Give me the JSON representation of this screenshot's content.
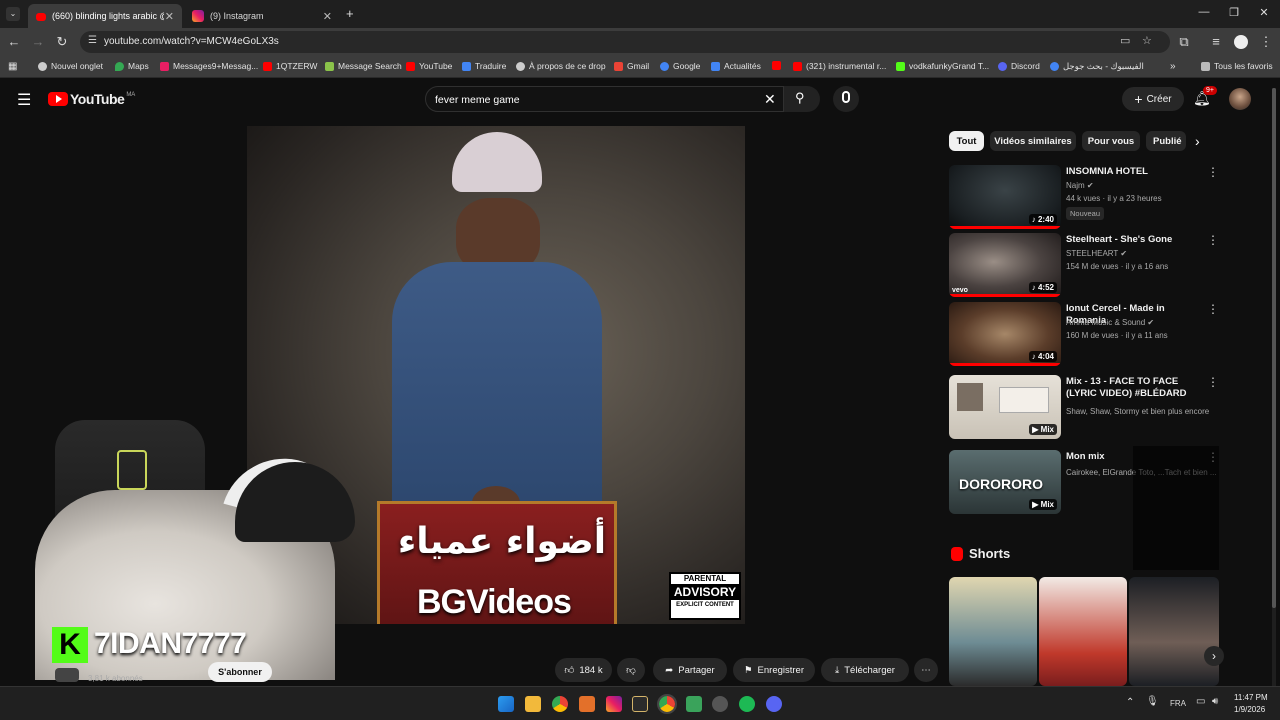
{
  "browser": {
    "tabs": [
      {
        "title": "(660) blinding lights arabic @..."
      },
      {
        "title": "(9) Instagram"
      }
    ],
    "url": "youtube.com/watch?v=MCW4eGoLX3s",
    "bookmarks": [
      "Nouvel onglet",
      "Maps",
      "Messages9+Messag...",
      "1QTZERW",
      "Message Search",
      "YouTube",
      "Traduire",
      "À propos de ce drop",
      "Gmail",
      "Google",
      "Actualités",
      "(321) instrumental r...",
      "vodkafunkyGrand T...",
      "Discord",
      "الفيسبوك - بحث جوجل"
    ],
    "all_favorites": "Tous les favoris"
  },
  "youtube": {
    "logo": "YouTube",
    "logo_sup": "MA",
    "search_query": "fever meme game",
    "create_label": "Créer",
    "notif_count": "9+"
  },
  "video": {
    "arabic_title": "أضواء عمياء",
    "watermark": "BGVideos",
    "advisory_line1": "PARENTAL",
    "advisory_line2": "ADVISORY",
    "advisory_line3": "EXPLICIT CONTENT"
  },
  "overlay": {
    "streamer_name": "7IDAN7777",
    "logo_letter": "K"
  },
  "channel": {
    "subscribers": "3,81 k abonnés",
    "subscribe_label": "S'abonner"
  },
  "actions": {
    "likes": "184 k",
    "share": "Partager",
    "save": "Enregistrer",
    "download": "Télécharger"
  },
  "chips": [
    "Tout",
    "Vidéos similaires",
    "Pour vous",
    "Publié"
  ],
  "recommendations": [
    {
      "title": "INSOMNIA HOTEL",
      "channel": "Najm",
      "meta": "44 k vues · il y a 23 heures",
      "duration": "2:40",
      "badge": "Nouveau"
    },
    {
      "title": "Steelheart - She's Gone",
      "channel": "STEELHEART",
      "meta": "154 M de vues · il y a 16 ans",
      "duration": "4:52",
      "badge": ""
    },
    {
      "title": "Ionut Cercel - Made in Romania",
      "channel": "Amma Music & Sound",
      "meta": "160 M de vues · il y a 11 ans",
      "duration": "4:04",
      "badge": ""
    },
    {
      "title": "Mix - 13 - FACE TO FACE (LYRIC VIDEO) #BLÉDARD",
      "channel": "Shaw, Shaw, Stormy et bien plus encore",
      "meta": "",
      "duration": "Mix",
      "badge": ""
    },
    {
      "title": "Mon mix",
      "channel": "Cairokee, ElGrande Toto, ...Tach et bien ...",
      "meta": "",
      "duration": "Mix",
      "badge": ""
    }
  ],
  "mix_thumb_text": "DORORORO",
  "shorts_label": "Shorts",
  "system": {
    "lang": "FRA",
    "time": "11:47 PM",
    "date": "1/9/2026"
  },
  "colors": {
    "yt_red": "#ff0000",
    "bg": "#0f0f0f",
    "chip_bg": "#272727",
    "overlay_green": "#53fc18"
  }
}
